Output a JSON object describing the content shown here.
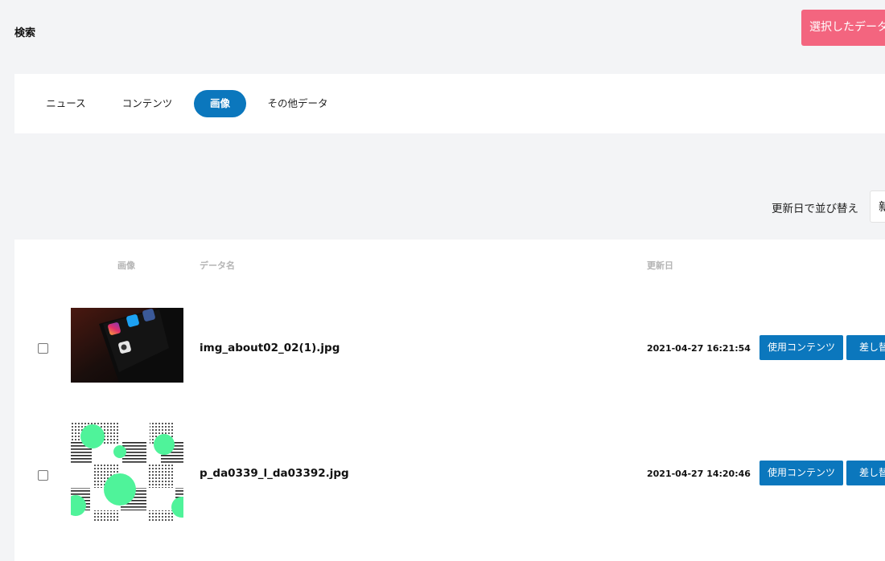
{
  "header": {
    "title": "検索",
    "delete_button_label": "選択したデータを削除"
  },
  "tabs": [
    {
      "label": "ニュース",
      "active": false
    },
    {
      "label": "コンテンツ",
      "active": false
    },
    {
      "label": "画像",
      "active": true
    },
    {
      "label": "その他データ",
      "active": false
    }
  ],
  "sort": {
    "label": "更新日で並び替え",
    "selected": "新しい順"
  },
  "table": {
    "headers": {
      "image": "画像",
      "name": "データ名",
      "updated": "更新日"
    },
    "rows": [
      {
        "file_name": "img_about02_02(1).jpg",
        "updated": "2021-04-27 16:21:54",
        "usage_button": "使用コンテンツ",
        "replace_button": "差し替え",
        "thumbnail": "phone-social-apps-photo"
      },
      {
        "file_name": "p_da0339_l_da03392.jpg",
        "updated": "2021-04-27 14:20:46",
        "usage_button": "使用コンテンツ",
        "replace_button": "差し替え",
        "thumbnail": "green-dots-stripes-pattern"
      }
    ]
  },
  "colors": {
    "primary": "#0b77bd",
    "danger": "#f3657f",
    "background": "#f3f4f6",
    "accent_green": "#4ff39a"
  }
}
